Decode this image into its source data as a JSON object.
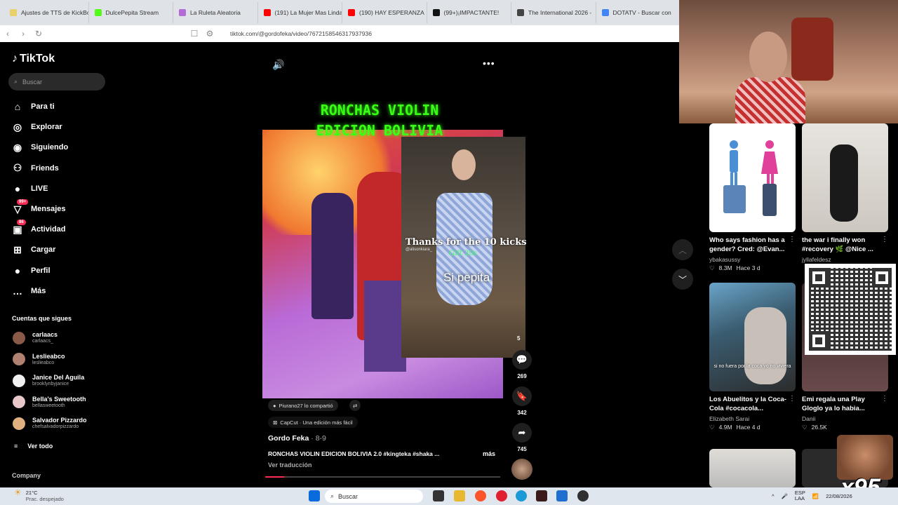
{
  "browser": {
    "tabs": [
      {
        "label": "Ajustes de TTS de KickBot",
        "color": "#e8d06b"
      },
      {
        "label": "DulcePepita Stream",
        "color": "#53fc18"
      },
      {
        "label": "La Ruleta Aleatoria",
        "color": "#b36bd6"
      },
      {
        "label": "(191) La Mujer Mas Linda",
        "color": "#ff0000"
      },
      {
        "label": "(190) HAY ESPERANZA",
        "color": "#ff0000"
      },
      {
        "label": "(99+)¡IMPACTANTE!",
        "color": "#111111"
      },
      {
        "label": "The International 2026 -",
        "color": "#444444"
      },
      {
        "label": "DOTATV - Buscar con",
        "color": "#4285f4"
      }
    ],
    "url": "tiktok.com/@gordofeka/video/7672158546317937936"
  },
  "sidebar": {
    "logo": "TikTok",
    "search_placeholder": "Buscar",
    "nav": [
      {
        "label": "Para ti",
        "icon": "home-icon"
      },
      {
        "label": "Explorar",
        "icon": "compass-icon"
      },
      {
        "label": "Siguiendo",
        "icon": "following-icon"
      },
      {
        "label": "Friends",
        "icon": "friends-icon"
      },
      {
        "label": "LIVE",
        "icon": "live-icon"
      },
      {
        "label": "Mensajes",
        "icon": "messages-icon",
        "badge": "99+"
      },
      {
        "label": "Actividad",
        "icon": "activity-icon",
        "badge": "86"
      },
      {
        "label": "Cargar",
        "icon": "upload-icon"
      },
      {
        "label": "Perfil",
        "icon": "profile-icon"
      },
      {
        "label": "Más",
        "icon": "more-icon"
      }
    ],
    "following_title": "Cuentas que sigues",
    "following": [
      {
        "name": "carlaacs",
        "handle": "carlaacs_"
      },
      {
        "name": "Leslieabco",
        "handle": "leslieabco"
      },
      {
        "name": "Janice Del Aguila",
        "handle": "brooklynbyjanice"
      },
      {
        "name": "Bella's Sweetooth",
        "handle": "bellasweetooth"
      },
      {
        "name": "Salvador Pizzardo",
        "handle": "chefsalvadorpizzardo"
      }
    ],
    "see_all": "Ver todo",
    "company": "Company"
  },
  "video": {
    "title_line1": "RONCHAS VIOLIN",
    "title_line2": "EDICION BOLIVIA",
    "overlay_text": "Thanks for the 10 kicks",
    "overlay_handle": "@alisonkiara_",
    "overlay_gift": "Gift 20s",
    "overlay_caption": "Si pepita",
    "shared_by": "Piurano27 lo compartió",
    "capcut": "CapCut · Una edición más fácil",
    "author": "Gordo Feka",
    "date": "· 8-9",
    "caption": "RONCHAS VIOLIN EDICION BOLIVIA 2.0 #kingteka #shaka ...",
    "more": "más",
    "translate": "Ver traducción",
    "progress": 0.08,
    "actions": [
      {
        "icon": "comment-icon",
        "count": "269"
      },
      {
        "icon": "bookmark-icon",
        "count": "342"
      },
      {
        "icon": "share-icon",
        "count": "745"
      }
    ],
    "partial_count": "5"
  },
  "grid": [
    {
      "title": "Who says fashion has a gender? Cred: @Evan...",
      "author": "ybakasussy",
      "likes": "8.3M",
      "age": "Hace 3 d"
    },
    {
      "title": "the war i finally won #recovery 🌿 @Nice ...",
      "author": "jyllafeldesz",
      "likes": "",
      "age": ""
    },
    {
      "title": "Los Abuelitos y la Coca-Cola #cocacola...",
      "author": "Elizabeth Sarai",
      "likes": "4.9M",
      "age": "Hace 4 d",
      "overlay": "si no fuera por la coca yo no viviera"
    },
    {
      "title": "Emi regala una Play Gloglo ya lo habia...",
      "author": "Danii",
      "likes": "26.5K",
      "age": ""
    }
  ],
  "stream_overlay": {
    "multiplier": "x95"
  },
  "taskbar": {
    "temp": "21°C",
    "weather": "Prac. despejado",
    "search": "Buscar",
    "lang1": "ESP",
    "lang2": "LAA",
    "date": "22/08/2026"
  }
}
